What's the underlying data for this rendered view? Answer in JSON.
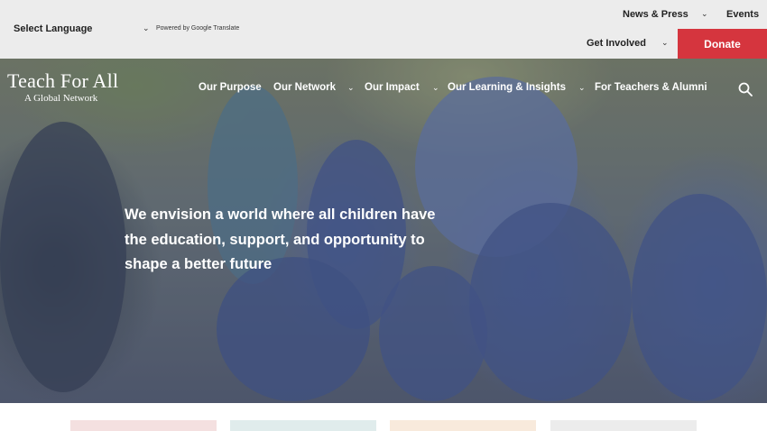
{
  "topbar": {
    "language_label": "Select Language",
    "powered_by": "Powered by Google Translate",
    "news_label": "News & Press",
    "events_label": "Events",
    "involved_label": "Get Involved",
    "donate_label": "Donate"
  },
  "brand": {
    "title": "Teach For All",
    "subtitle": "A Global Network"
  },
  "nav": {
    "items": [
      {
        "label": "Our Purpose",
        "has_dropdown": false
      },
      {
        "label": "Our Network",
        "has_dropdown": true
      },
      {
        "label": "Our Impact",
        "has_dropdown": true
      },
      {
        "label": "Our Learning & Insights",
        "has_dropdown": true
      },
      {
        "label": "For Teachers & Alumni",
        "has_dropdown": false
      }
    ],
    "search_icon": "search-icon"
  },
  "hero": {
    "headline": "We envision a world where all children have the education, support, and opportunity to shape a better future"
  },
  "cards": {
    "colors": [
      "#f4e0e0",
      "#e0ecec",
      "#f8eadc",
      "#ececec"
    ]
  },
  "colors": {
    "donate": "#d5353e",
    "topbar": "#ececec"
  }
}
